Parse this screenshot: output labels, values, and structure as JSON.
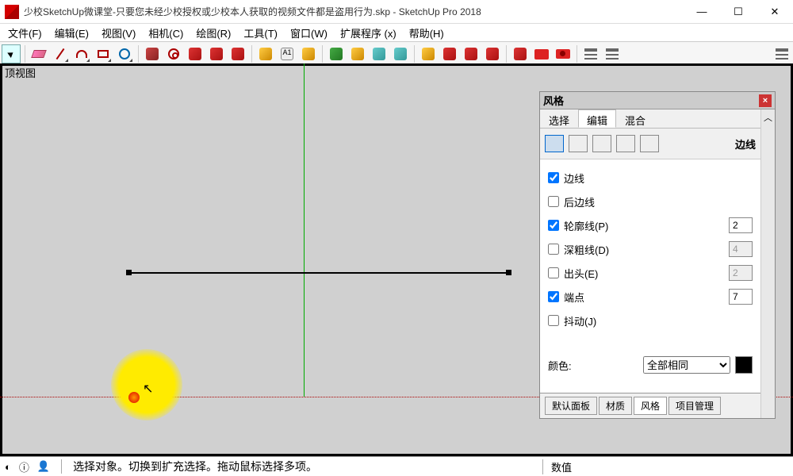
{
  "window": {
    "title": "少校SketchUp微课堂-只要您未经少校授权或少校本人获取的视频文件都是盗用行为.skp - SketchUp Pro 2018"
  },
  "menu": {
    "file": "文件(F)",
    "edit": "编辑(E)",
    "view": "视图(V)",
    "camera": "相机(C)",
    "draw": "绘图(R)",
    "tools": "工具(T)",
    "window": "窗口(W)",
    "ext": "扩展程序 (x)",
    "help": "帮助(H)"
  },
  "viewport": {
    "label": "顶视图"
  },
  "styles_panel": {
    "title": "风格",
    "tabs": {
      "select": "选择",
      "edit": "编辑",
      "mix": "混合"
    },
    "active_tab": "编辑",
    "section_label": "边线",
    "options": {
      "edges": {
        "label": "边线",
        "checked": true
      },
      "back_edges": {
        "label": "后边线",
        "checked": false
      },
      "profiles": {
        "label": "轮廓线(P)",
        "checked": true,
        "value": "2"
      },
      "depth_cue": {
        "label": "深粗线(D)",
        "checked": false,
        "value": "4"
      },
      "extension": {
        "label": "出头(E)",
        "checked": false,
        "value": "2"
      },
      "endpoints": {
        "label": "端点",
        "checked": true,
        "value": "7"
      },
      "jitter": {
        "label": "抖动(J)",
        "checked": false
      }
    },
    "color_label": "颜色:",
    "color_mode": "全部相同",
    "bottom_tabs": {
      "default": "默认面板",
      "materials": "材质",
      "styles": "风格",
      "project": "项目管理",
      "active": "风格"
    }
  },
  "statusbar": {
    "hint": "选择对象。切换到扩充选择。拖动鼠标选择多项。",
    "vcb_label": "数值"
  }
}
